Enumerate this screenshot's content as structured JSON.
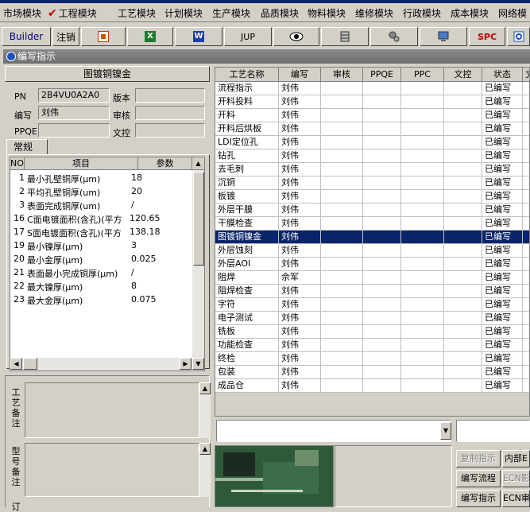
{
  "menu": [
    {
      "label": "市场模块"
    },
    {
      "label": "工程模块",
      "checked": true
    },
    {
      "label": "工艺模块"
    },
    {
      "label": "计划模块"
    },
    {
      "label": "生产模块"
    },
    {
      "label": "品质模块"
    },
    {
      "label": "物料模块"
    },
    {
      "label": "维修模块"
    },
    {
      "label": "行政模块"
    },
    {
      "label": "成本模块"
    },
    {
      "label": "网络模"
    }
  ],
  "toolbar": {
    "builder": "Builder",
    "logout": "注销",
    "jup": "JUP",
    "spc": "SPC"
  },
  "window": {
    "title": "编写指示"
  },
  "left": {
    "header": "图镀铜镍金",
    "fields": {
      "pn_label": "PN",
      "pn_value": "2B4VU0A2A0",
      "version_label": "版本",
      "version_value": "",
      "author_label": "编写",
      "author_value": "刘伟",
      "review_label": "审核",
      "review_value": "",
      "ppqe_label": "PPQE",
      "ppqe_value": "",
      "doccontrol_label": "文控",
      "doccontrol_value": ""
    },
    "tab": "常规",
    "param_headers": {
      "no": "NO",
      "item": "项目",
      "param": "参数"
    },
    "params": [
      {
        "no": "1",
        "item": "最小孔壁铜厚(μm)",
        "value": "18"
      },
      {
        "no": "2",
        "item": "平均孔壁铜厚(um)",
        "value": "20"
      },
      {
        "no": "3",
        "item": "表面完成铜厚(um)",
        "value": "/"
      },
      {
        "no": "16",
        "item": "C面电镀面积(含孔)(平方",
        "value": "120.65"
      },
      {
        "no": "17",
        "item": "S面电镀面积(含孔)(平方",
        "value": "138.18"
      },
      {
        "no": "19",
        "item": "最小镍厚(μm)",
        "value": "3"
      },
      {
        "no": "20",
        "item": "最小金厚(μm)",
        "value": "0.025"
      },
      {
        "no": "21",
        "item": "表面最小完成铜厚(μm)",
        "value": "/"
      },
      {
        "no": "22",
        "item": "最大镍厚(μm)",
        "value": "8"
      },
      {
        "no": "23",
        "item": "最大金厚(μm)",
        "value": "0.075"
      }
    ],
    "remark1_label": "工艺备注",
    "remark2_label": "型号备注",
    "remark3_label": "订"
  },
  "process": {
    "headers": [
      "工艺名称",
      "编写",
      "审核",
      "PPQE",
      "PPC",
      "文控",
      "状态",
      "文"
    ],
    "rows": [
      {
        "name": "流程指示",
        "author": "刘伟",
        "status": "已编写"
      },
      {
        "name": "开料投料",
        "author": "刘伟",
        "status": "已编写"
      },
      {
        "name": "开料",
        "author": "刘伟",
        "status": "已编写"
      },
      {
        "name": "开料后烘板",
        "author": "刘伟",
        "status": "已编写"
      },
      {
        "name": "LDI定位孔",
        "author": "刘伟",
        "status": "已编写"
      },
      {
        "name": "钻孔",
        "author": "刘伟",
        "status": "已编写"
      },
      {
        "name": "去毛刺",
        "author": "刘伟",
        "status": "已编写"
      },
      {
        "name": "沉铜",
        "author": "刘伟",
        "status": "已编写"
      },
      {
        "name": "板镀",
        "author": "刘伟",
        "status": "已编写"
      },
      {
        "name": "外层干膜",
        "author": "刘伟",
        "status": "已编写"
      },
      {
        "name": "干膜检查",
        "author": "刘伟",
        "status": "已编写"
      },
      {
        "name": "图镀铜镍金",
        "author": "刘伟",
        "status": "已编写",
        "selected": true
      },
      {
        "name": "外层蚀刻",
        "author": "刘伟",
        "status": "已编写"
      },
      {
        "name": "外层AOI",
        "author": "刘伟",
        "status": "已编写"
      },
      {
        "name": "阻焊",
        "author": "佘军",
        "status": "已编写"
      },
      {
        "name": "阻焊检查",
        "author": "刘伟",
        "status": "已编写"
      },
      {
        "name": "字符",
        "author": "刘伟",
        "status": "已编写"
      },
      {
        "name": "电子测试",
        "author": "刘伟",
        "status": "已编写"
      },
      {
        "name": "铣板",
        "author": "刘伟",
        "status": "已编写"
      },
      {
        "name": "功能检查",
        "author": "刘伟",
        "status": "已编写"
      },
      {
        "name": "终检",
        "author": "刘伟",
        "status": "已编写"
      },
      {
        "name": "包装",
        "author": "刘伟",
        "status": "已编写"
      },
      {
        "name": "成品仓",
        "author": "刘伟",
        "status": "已编写"
      }
    ]
  },
  "bottom_buttons": {
    "copy": "复制指示",
    "write_flow": "编写流程",
    "write_instr": "编写指示",
    "internal": "内部E",
    "ecn_impact": "ECN影",
    "ecn_review": "ECN审"
  }
}
